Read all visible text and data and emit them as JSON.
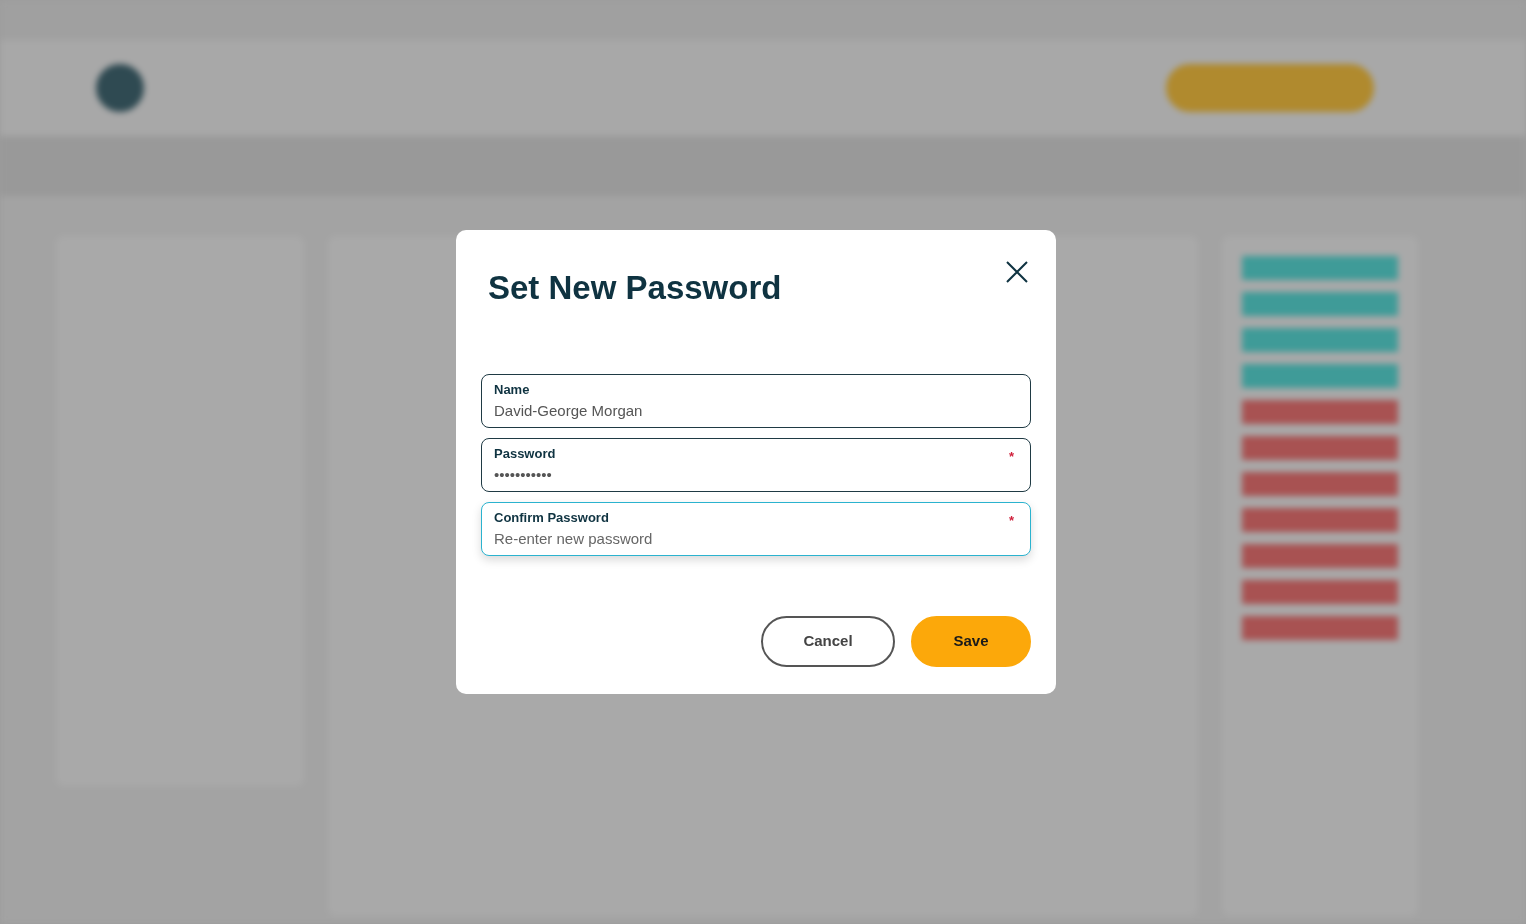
{
  "dialog": {
    "title": "Set New Password",
    "fields": [
      {
        "label": "Name",
        "value": "David-George Morgan",
        "focused": false
      },
      {
        "label": "Password",
        "value": "•••••••••••",
        "required_mark": "*",
        "focused": false
      },
      {
        "label": "Confirm Password",
        "placeholder": "Re-enter new password",
        "required_mark": "*",
        "focused": true
      }
    ],
    "buttons": [
      {
        "label": "Cancel",
        "kind": "secondary"
      },
      {
        "label": "Save",
        "kind": "primary"
      }
    ]
  }
}
